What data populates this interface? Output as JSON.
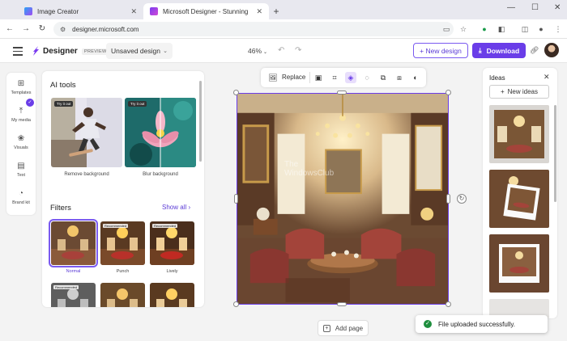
{
  "browser": {
    "tabs": [
      {
        "title": "Image Creator",
        "active": false
      },
      {
        "title": "Microsoft Designer - Stunning",
        "active": true
      }
    ],
    "url": "designer.microsoft.com"
  },
  "header": {
    "brand": "Designer",
    "badge": "PREVIEW",
    "doc_name": "Unsaved design",
    "zoom": "46%",
    "new_design": "+ New design",
    "download": "Download"
  },
  "rail": {
    "items": [
      "Templates",
      "My media",
      "Visuals",
      "Text",
      "Brand kit"
    ]
  },
  "panel": {
    "ai_tools_title": "AI tools",
    "tools": [
      {
        "label": "Remove background",
        "tag": "Try it out"
      },
      {
        "label": "Blur background",
        "tag": "Try it out"
      }
    ],
    "filters_title": "Filters",
    "show_all": "Show all",
    "filters": [
      {
        "label": "Normal",
        "tag": "",
        "selected": true
      },
      {
        "label": "Punch",
        "tag": "Recommended",
        "selected": false
      },
      {
        "label": "Lively",
        "tag": "Recommended",
        "selected": false
      },
      {
        "label": "",
        "tag": "Recommended",
        "selected": false
      },
      {
        "label": "",
        "tag": "",
        "selected": false
      },
      {
        "label": "",
        "tag": "",
        "selected": false
      }
    ]
  },
  "canvas_toolbar": {
    "replace": "Replace"
  },
  "canvas": {
    "watermark": "The WindowsClub"
  },
  "add_page": "Add page",
  "ideas": {
    "title": "Ideas",
    "new_ideas": "New ideas"
  },
  "toast": {
    "message": "File uploaded successfully."
  },
  "colors": {
    "accent": "#6a3de8",
    "success": "#1e8e3e"
  }
}
